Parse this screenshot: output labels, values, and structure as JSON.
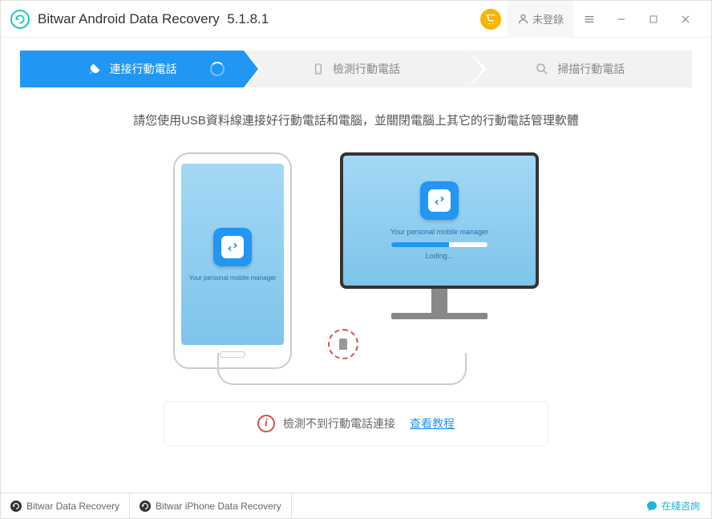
{
  "titlebar": {
    "app_name": "Bitwar Android Data Recovery",
    "version": "5.1.8.1",
    "login_label": "未登錄"
  },
  "steps": [
    {
      "label": "連接行動電話",
      "icon": "plug-icon",
      "active": true
    },
    {
      "label": "檢測行動電話",
      "icon": "device-icon",
      "active": false
    },
    {
      "label": "掃描行動電話",
      "icon": "search-icon",
      "active": false
    }
  ],
  "main": {
    "instruction": "請您使用USB資料線連接好行動電話和電腦，並關閉電腦上其它的行動電話管理軟體",
    "phone_manager_text": "Your personal mobile manager",
    "monitor_manager_text": "Your personal mobile manager",
    "monitor_loading_text": "Loding...",
    "status_text": "檢測不到行動電話連接",
    "tutorial_link": "查看教程"
  },
  "footer": {
    "product1": "Bitwar Data Recovery",
    "product2": "Bitwar iPhone Data Recovery",
    "chat_label": "在綫咨詢"
  }
}
